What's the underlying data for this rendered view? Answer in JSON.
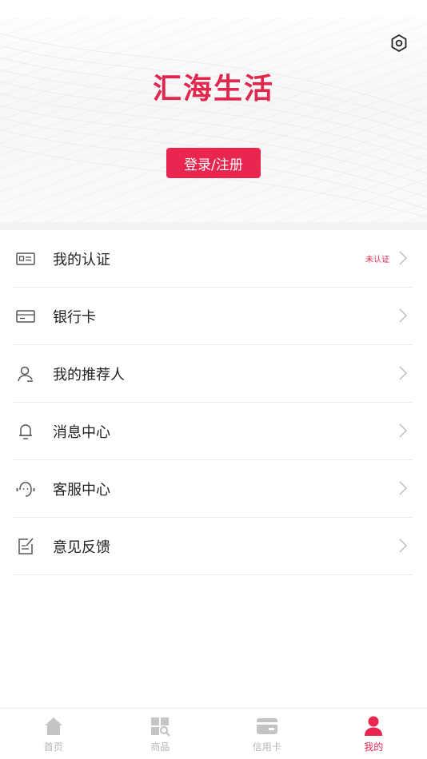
{
  "header": {
    "app_title": "汇海生活",
    "login_label": "登录/注册"
  },
  "menu": {
    "items": [
      {
        "label": "我的认证",
        "status": "未认证",
        "icon": "id-card-icon"
      },
      {
        "label": "银行卡",
        "icon": "bank-card-icon"
      },
      {
        "label": "我的推荐人",
        "icon": "user-icon"
      },
      {
        "label": "消息中心",
        "icon": "bell-icon"
      },
      {
        "label": "客服中心",
        "icon": "headset-icon"
      },
      {
        "label": "意见反馈",
        "icon": "feedback-icon"
      }
    ]
  },
  "tabbar": {
    "items": [
      {
        "label": "首页",
        "icon": "home-icon"
      },
      {
        "label": "商品",
        "icon": "grid-search-icon"
      },
      {
        "label": "信用卡",
        "icon": "credit-card-icon"
      },
      {
        "label": "我的",
        "icon": "person-icon",
        "active": true
      }
    ]
  },
  "colors": {
    "accent": "#e8264f",
    "text": "#222222",
    "inactive": "#b5b5b5"
  }
}
